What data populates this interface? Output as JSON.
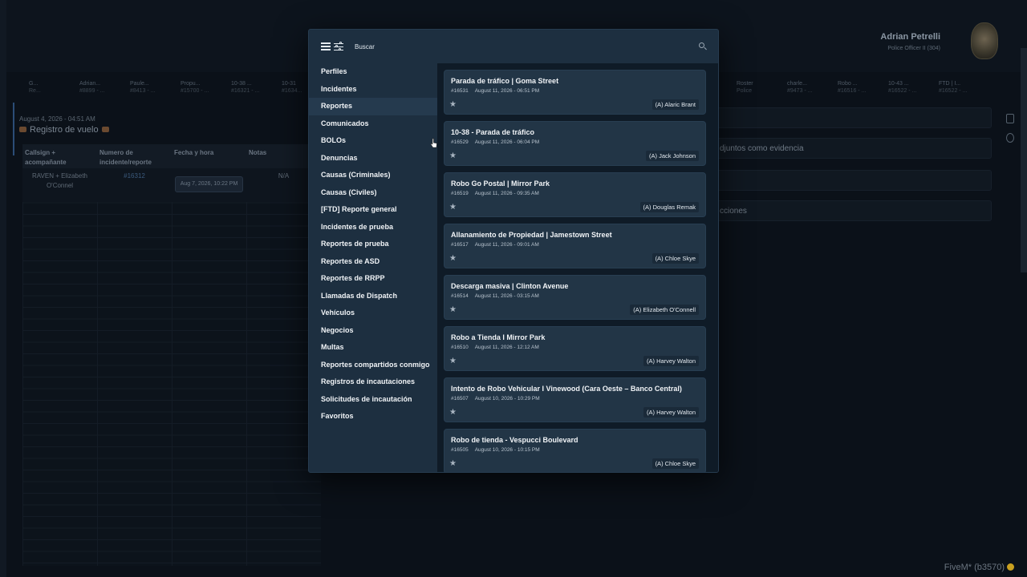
{
  "background": {
    "user": {
      "name": "Adrian Petrelli",
      "rank": "Police Officer II (304)"
    },
    "tabs": [
      {
        "t": "G...",
        "s": "Re..."
      },
      {
        "t": "Adrian...",
        "s": "#8899 - ..."
      },
      {
        "t": "Paule...",
        "s": "#8413 - ..."
      },
      {
        "t": "Propu...",
        "s": "#15700 - ..."
      },
      {
        "t": "10-38 ...",
        "s": "#16321 - ..."
      },
      {
        "t": "10-31",
        "s": "#1634..."
      },
      {
        "t": "",
        "s": ""
      },
      {
        "t": "",
        "s": ""
      },
      {
        "t": "",
        "s": ""
      },
      {
        "t": "",
        "s": ""
      },
      {
        "t": "",
        "s": ""
      },
      {
        "t": "",
        "s": ""
      },
      {
        "t": "",
        "s": ""
      },
      {
        "t": "11...",
        "s": "#16..."
      },
      {
        "t": "Roster",
        "s": "Police"
      },
      {
        "t": "charle...",
        "s": "#9473 - ..."
      },
      {
        "t": "Robo ...",
        "s": "#16516 - ..."
      },
      {
        "t": "10-43 ...",
        "s": "#16522 - ..."
      },
      {
        "t": "FTD | I...",
        "s": "#16522 - ..."
      }
    ],
    "record_date": "August 4, 2026 - 04:51 AM",
    "record_title": "Registro de vuelo",
    "table": {
      "headers": [
        "Callsign + acompañante",
        "Numero de incidente/reporte",
        "Fecha y hora",
        "Notas"
      ],
      "row": {
        "callsign": "RAVEN + Elizabeth O'Connel",
        "incident": "#16312",
        "datetime": "Aug 7, 2026, 10:22 PM",
        "notes": "N/A"
      }
    },
    "right_cards": [
      "",
      "djuntos como evidencia",
      "",
      "cciones"
    ],
    "footer": "FiveM* (b3570)"
  },
  "modal": {
    "search_placeholder": "Buscar",
    "nav": [
      "Perfiles",
      "Incidentes",
      "Reportes",
      "Comunicados",
      "BOLOs",
      "Denuncias",
      "Causas (Criminales)",
      "Causas (Civiles)",
      "[FTD] Reporte general",
      "Incidentes de prueba",
      "Reportes de prueba",
      "Reportes de ASD",
      "Reportes de RRPP",
      "Llamadas de Dispatch",
      "Vehículos",
      "Negocios",
      "Multas",
      "Reportes compartidos conmigo",
      "Registros de incautaciones",
      "Solicitudes de incautación",
      "Favoritos"
    ],
    "active_nav": "Reportes",
    "results": [
      {
        "title": "Parada de tráfico | Goma Street",
        "id": "#16531",
        "date": "August 11, 2026 - 06:51 PM",
        "author": "(A) Alaric Brant"
      },
      {
        "title": "10-38 - Parada de tráfico",
        "id": "#16529",
        "date": "August 11, 2026 - 06:04 PM",
        "author": "(A) Jack Johnson"
      },
      {
        "title": "Robo Go Postal | Mirror Park",
        "id": "#16519",
        "date": "August 11, 2026 - 09:35 AM",
        "author": "(A) Douglas Remak"
      },
      {
        "title": "Allanamiento de Propiedad | Jamestown Street",
        "id": "#16517",
        "date": "August 11, 2026 - 09:01 AM",
        "author": "(A) Chloe Skye"
      },
      {
        "title": "Descarga masiva | Clinton Avenue",
        "id": "#16514",
        "date": "August 11, 2026 - 03:15 AM",
        "author": "(A) Elizabeth O'Connell"
      },
      {
        "title": "Robo a Tienda I Mirror Park",
        "id": "#16510",
        "date": "August 11, 2026 - 12:12 AM",
        "author": "(A) Harvey Walton"
      },
      {
        "title": "Intento de Robo Vehicular I Vinewood (Cara Oeste – Banco Central)",
        "id": "#16507",
        "date": "August 10, 2026 - 10:29 PM",
        "author": "(A) Harvey Walton"
      },
      {
        "title": "Robo de tienda - Vespucci Boulevard",
        "id": "#16505",
        "date": "August 10, 2026 - 10:15 PM",
        "author": "(A) Chloe Skye"
      }
    ]
  }
}
